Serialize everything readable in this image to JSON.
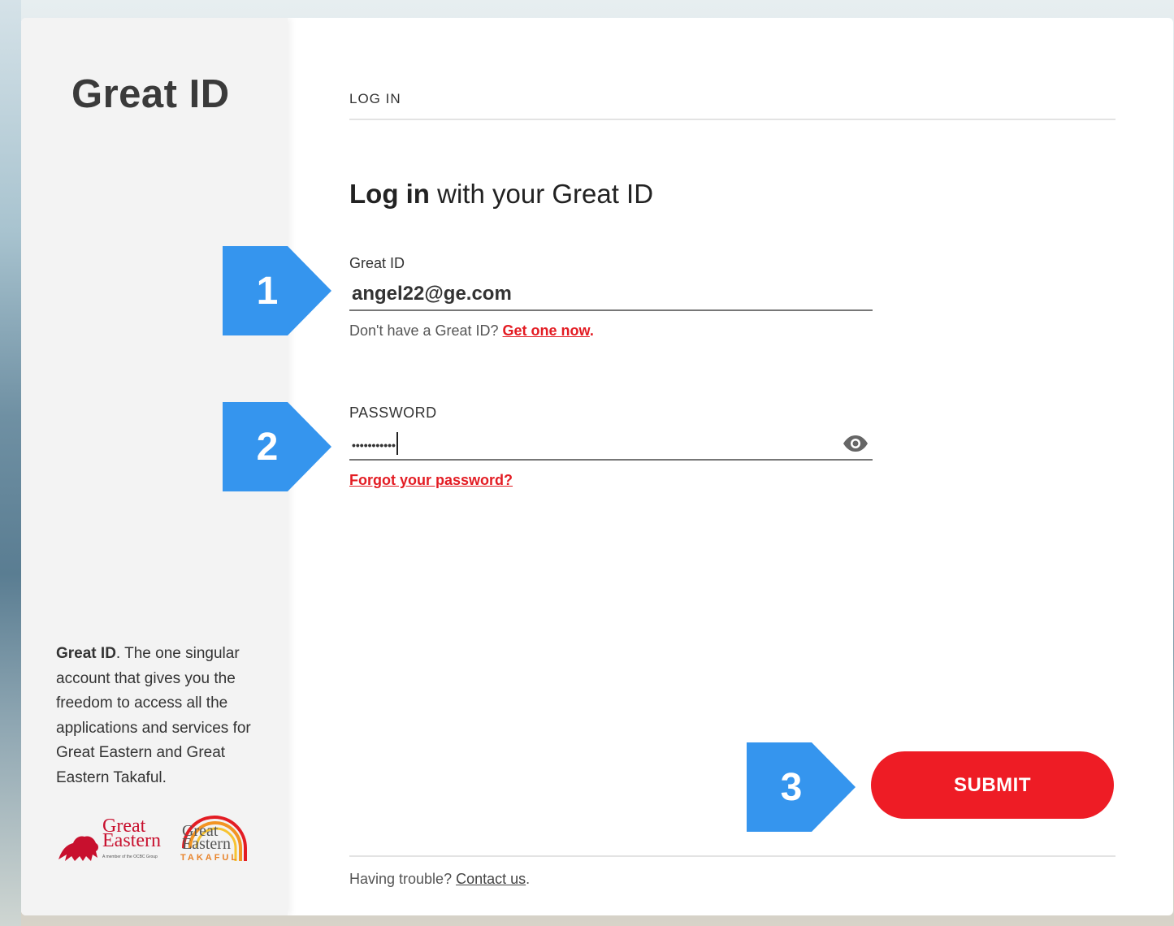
{
  "brand": {
    "title": "Great ID",
    "blurb_bold": "Great ID",
    "blurb_rest": ". The one singular account that gives you the freedom to access all the applications and services for Great Eastern and Great Eastern Takaful.",
    "logo_ge_line1": "Great",
    "logo_ge_line2": "Eastern",
    "logo_ge_sub": "A member of the OCBC Group",
    "logo_tk_line1": "Great",
    "logo_tk_line2": "Eastern",
    "logo_tk_line3": "TAKAFUL"
  },
  "login": {
    "tab_label": "LOG IN",
    "heading_bold": "Log in",
    "heading_rest": " with your Great ID",
    "id_label": "Great ID",
    "id_value": "angel22@ge.com",
    "signup_prompt": "Don't have a Great ID? ",
    "signup_link": "Get one now",
    "signup_period": ".",
    "password_label": "PASSWORD",
    "password_value": "•••••••••••",
    "forgot_link": "Forgot your password?",
    "submit_label": "SUBMIT",
    "trouble_prompt": "Having trouble? ",
    "contact_link": "Contact us",
    "trouble_period": "."
  },
  "callouts": [
    "1",
    "2",
    "3"
  ],
  "colors": {
    "accent_red": "#ee1c25",
    "callout_blue": "#3595ee"
  }
}
